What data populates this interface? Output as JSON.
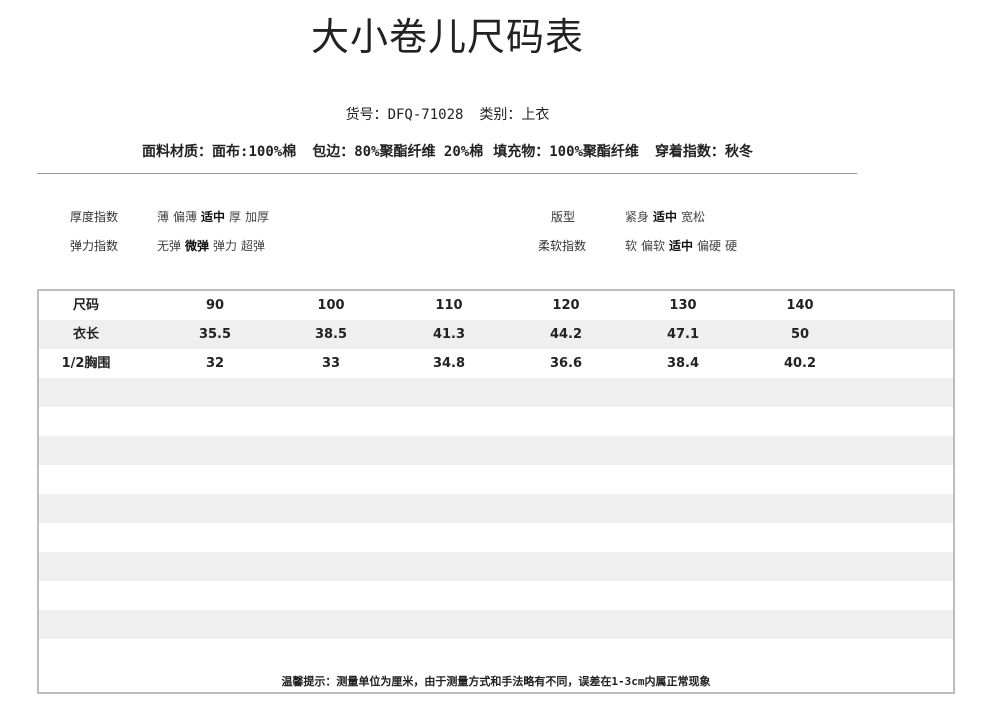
{
  "title": "大小卷儿尺码表",
  "product": {
    "item_no_label": "货号：",
    "item_no": "DFQ-71028",
    "category_label": "类别：",
    "category": "上衣"
  },
  "materials": {
    "fabric_label": "面料材质：",
    "fabric": "面布:100%棉",
    "binding": "包边：80%聚酯纤维 20%棉",
    "filling": "填充物：100%聚酯纤维",
    "season_label": "穿着指数：",
    "season": "秋冬"
  },
  "attributes": [
    {
      "label": "厚度指数",
      "options": [
        "薄",
        "偏薄",
        "适中",
        "厚",
        "加厚"
      ],
      "selected": "适中"
    },
    {
      "label": "弹力指数",
      "options": [
        "无弹",
        "微弹",
        "弹力",
        "超弹"
      ],
      "selected": "微弹"
    },
    {
      "label": "版型",
      "options": [
        "紧身",
        "适中",
        "宽松"
      ],
      "selected": "适中"
    },
    {
      "label": "柔软指数",
      "options": [
        "软",
        "偏软",
        "适中",
        "偏硬",
        "硬"
      ],
      "selected": "适中"
    }
  ],
  "size_table": {
    "rows": [
      {
        "label": "尺码",
        "values": [
          "90",
          "100",
          "110",
          "120",
          "130",
          "140"
        ]
      },
      {
        "label": "衣长",
        "values": [
          "35.5",
          "38.5",
          "41.3",
          "44.2",
          "47.1",
          "50"
        ]
      },
      {
        "label": "1/2胸围",
        "values": [
          "32",
          "33",
          "34.8",
          "36.6",
          "38.4",
          "40.2"
        ]
      }
    ]
  },
  "footer_note": "温馨提示：测量单位为厘米，由于测量方式和手法略有不同，误差在1-3cm内属正常现象"
}
